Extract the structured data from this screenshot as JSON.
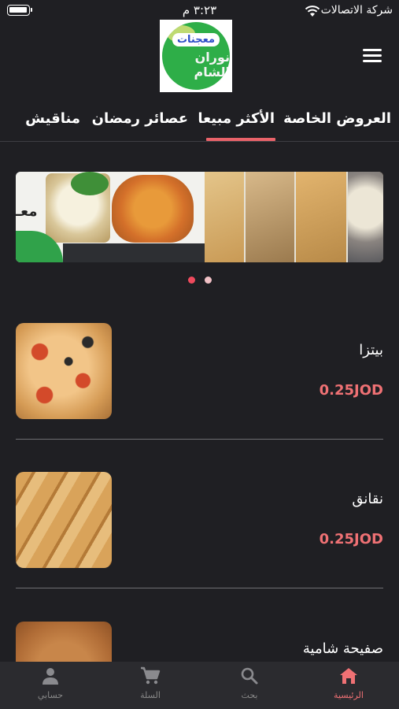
{
  "status_bar": {
    "carrier": "شركة الاتصالات",
    "time": "٣:٢٣ م"
  },
  "header": {
    "logo_line1": "معجنات",
    "logo_line2": "نوران الشام",
    "menu_icon": "hamburger-menu-icon"
  },
  "tabs": [
    {
      "label": "العروض الخاصة",
      "active": false
    },
    {
      "label": "الأكثر مبيعا",
      "active": true
    },
    {
      "label": "عصائر رمضان",
      "active": false
    },
    {
      "label": "مناقيش",
      "active": false
    }
  ],
  "carousel": {
    "slide_text": "معـ",
    "dots": [
      {
        "active": true
      },
      {
        "active": false
      }
    ]
  },
  "products": [
    {
      "name": "بيتزا",
      "price": "0.25JOD"
    },
    {
      "name": "نقانق",
      "price": "0.25JOD"
    },
    {
      "name": "صفيحة شامية",
      "price": ""
    }
  ],
  "bottom_nav": [
    {
      "label": "الرئيسية",
      "icon": "home-icon",
      "active": true
    },
    {
      "label": "بحث",
      "icon": "search-icon",
      "active": false
    },
    {
      "label": "السلة",
      "icon": "cart-icon",
      "active": false
    },
    {
      "label": "حسابي",
      "icon": "account-icon",
      "active": false
    }
  ],
  "colors": {
    "background": "#1f1f23",
    "accent": "#ef7174",
    "nav_background": "#2b2b2f",
    "logo_green": "#2eae48"
  }
}
